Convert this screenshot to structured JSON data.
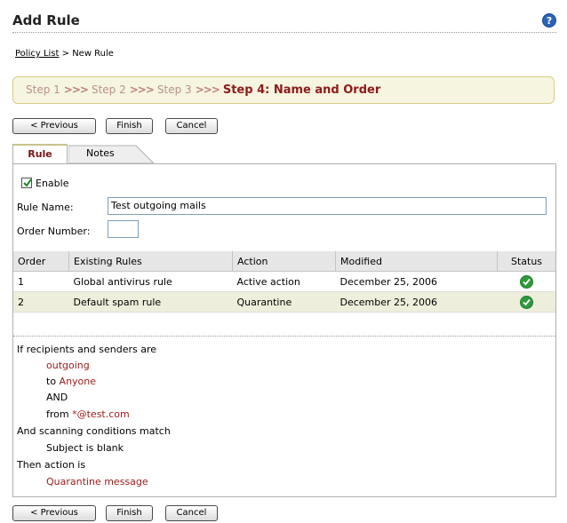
{
  "header": {
    "title": "Add Rule",
    "help_icon": "help-icon"
  },
  "breadcrumb": {
    "parent": "Policy List",
    "separator": " > ",
    "current": "New Rule"
  },
  "steps": {
    "items": [
      "Step 1",
      "Step 2",
      "Step 3"
    ],
    "separator": ">>>",
    "current": "Step 4: Name and Order"
  },
  "buttons": {
    "previous": "< Previous",
    "finish": "Finish",
    "cancel": "Cancel"
  },
  "tabs": {
    "rule": "Rule",
    "notes": "Notes"
  },
  "form": {
    "enable_label": "Enable",
    "enable_checked": true,
    "rule_name_label": "Rule Name:",
    "rule_name_value": "Test outgoing mails",
    "order_number_label": "Order Number:",
    "order_number_value": ""
  },
  "rules_table": {
    "headers": [
      "Order",
      "Existing Rules",
      "Action",
      "Modified",
      "Status"
    ],
    "rows": [
      {
        "order": "1",
        "name": "Global antivirus rule",
        "action": "Active action",
        "modified": "December 25, 2006",
        "status": "ok"
      },
      {
        "order": "2",
        "name": "Default spam rule",
        "action": "Quarantine",
        "modified": "December 25, 2006",
        "status": "ok"
      }
    ]
  },
  "summary": {
    "line1": "If recipients and senders are",
    "line2": "outgoing",
    "line3_prefix": "to",
    "line3_value": "Anyone",
    "line4": "AND",
    "line5_prefix": "from",
    "line5_value": "*@test.com",
    "line6": "And scanning conditions match",
    "line7": "Subject is blank",
    "line8": "Then action is",
    "line9": "Quarantine message"
  },
  "colors": {
    "accent": "#8e1a1a",
    "step_box": "#f6f5e0",
    "status_ok": "#2e9a3c"
  }
}
